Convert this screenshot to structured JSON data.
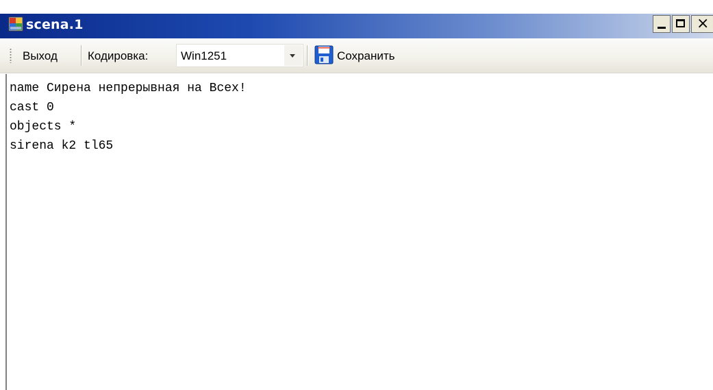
{
  "window": {
    "title": "scena.1",
    "icon": "app-window-icon",
    "controls": {
      "minimize_icon": "minimize-icon",
      "maximize_icon": "maximize-icon",
      "close_glyph": "×"
    },
    "colors": {
      "titlebar_start": "#0a2a8a",
      "titlebar_end": "#cbd6ea",
      "toolbar_bg": "#f2f1ea"
    }
  },
  "toolbar": {
    "exit_label": "Выход",
    "encoding_label": "Кодировка:",
    "encoding_value": "Win1251",
    "save_label": "Сохранить",
    "save_icon": "floppy-disk-icon"
  },
  "editor": {
    "lines": [
      "name Сирена непрерывная на Всех!",
      "cast 0",
      "objects *",
      "sirena k2 tl65"
    ]
  }
}
